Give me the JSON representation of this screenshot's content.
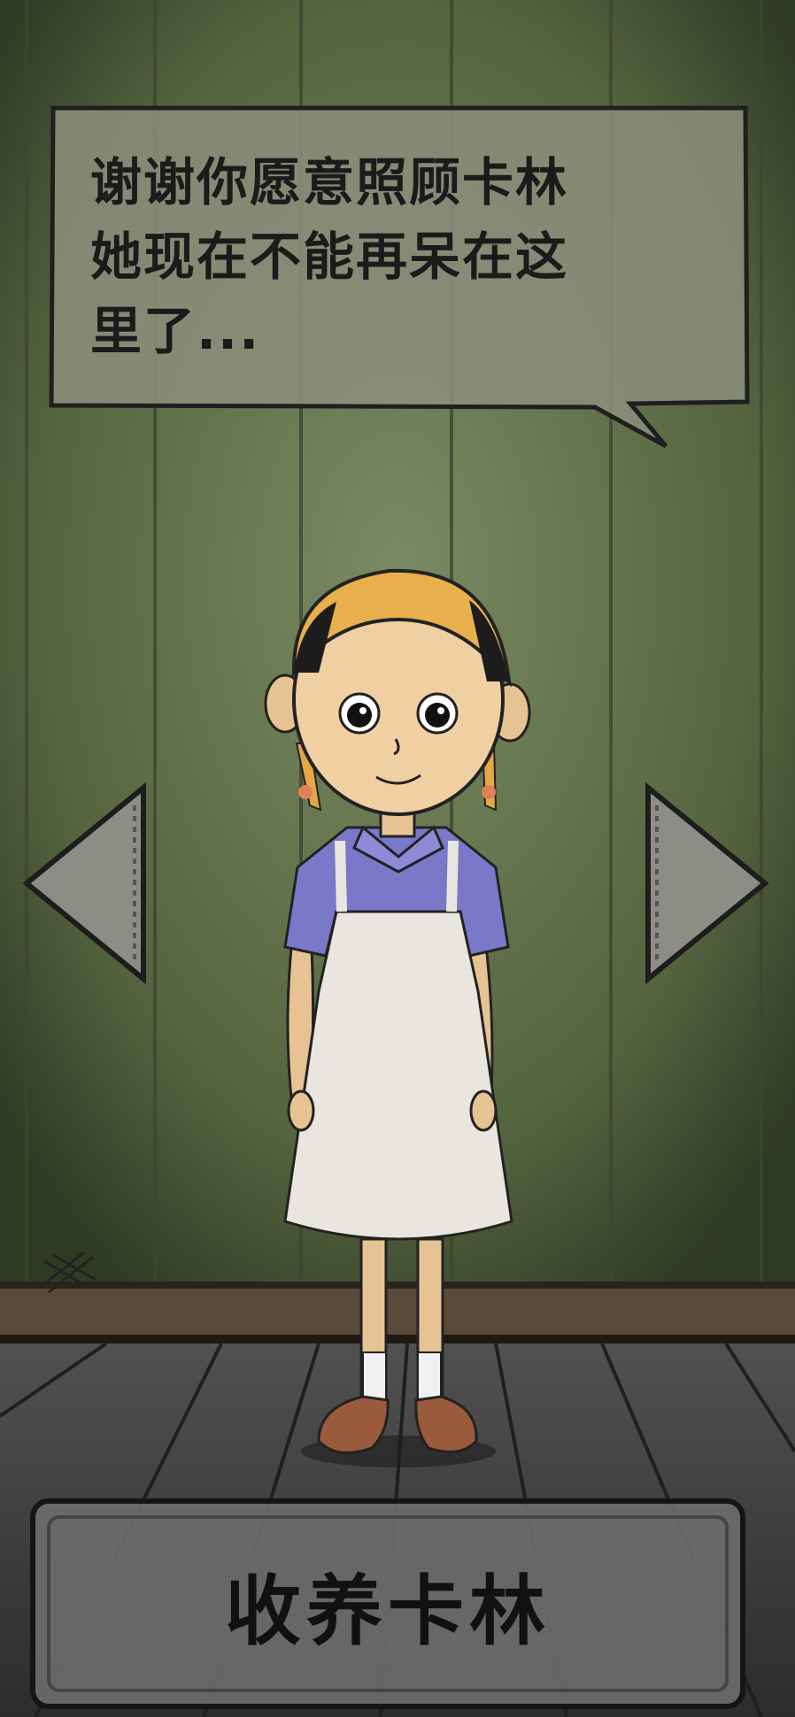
{
  "dialog": {
    "text": "谢谢你愿意照顾卡林\n她现在不能再呆在这\n里了..."
  },
  "character": {
    "name_icon": "girl-karin-character"
  },
  "nav": {
    "prev_icon": "left-triangle-icon",
    "next_icon": "right-triangle-icon"
  },
  "action": {
    "adopt_label": "收养卡林"
  },
  "colors": {
    "wall": "#5d6c4c",
    "floor": "#3e3f3e",
    "panel": "#8b8b82",
    "button": "#6e6e6e"
  }
}
